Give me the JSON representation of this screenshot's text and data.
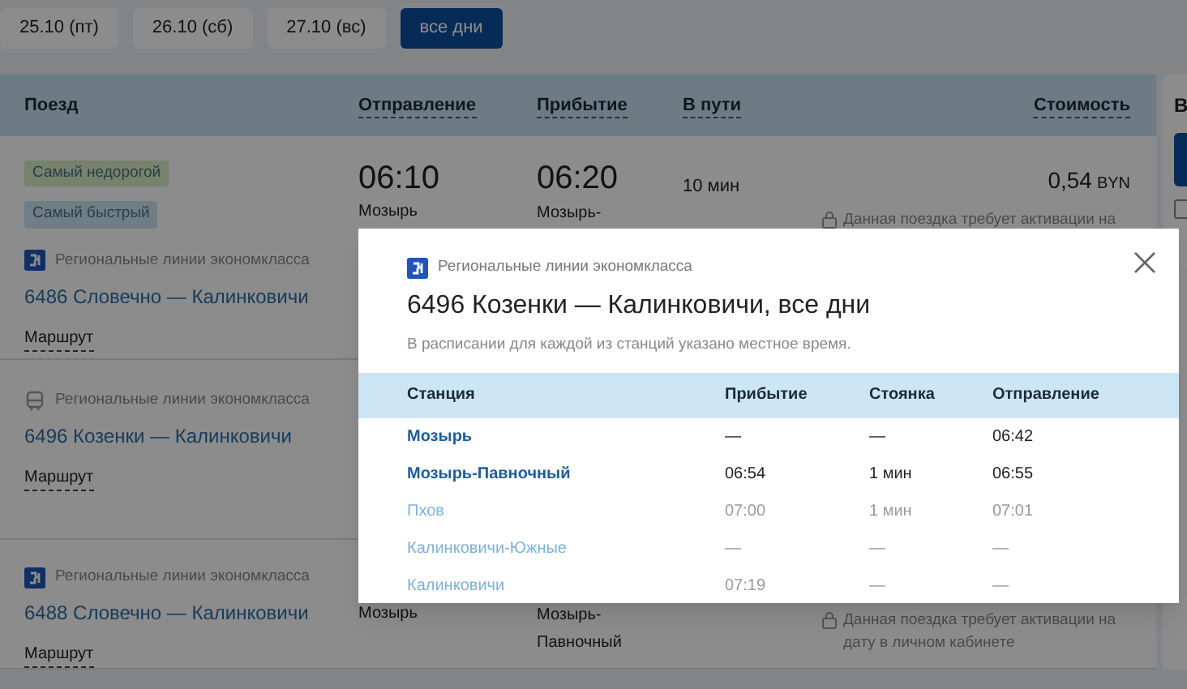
{
  "date_tabs": [
    {
      "label": "25.10 (пт)",
      "selected": false
    },
    {
      "label": "26.10 (сб)",
      "selected": false
    },
    {
      "label": "27.10 (вс)",
      "selected": false
    },
    {
      "label": "все дни",
      "selected": true
    }
  ],
  "table": {
    "columns": [
      "Поезд",
      "Отправление",
      "Прибытие",
      "В пути",
      "Стоимость"
    ],
    "rows": [
      {
        "badges": [
          {
            "label": "Самый недорогой",
            "color": "#76826c"
          },
          {
            "label": "Самый быстрый",
            "color": "#6f7d86"
          }
        ],
        "kind": "logo",
        "operator": "Региональные линии экономкласса",
        "train": "6486 Словечно — Калинковичи",
        "route_link": "Маршрут",
        "departure_time": "06:10",
        "departure_station": "Мозырь",
        "arrival_time": "06:20",
        "arrival_station": "Мозырь-",
        "duration": "10 мин",
        "price": "0,54",
        "currency": "BYN",
        "notice": "Данная поездка требует активации на"
      },
      {
        "kind": "train",
        "operator": "Региональные линии экономкласса",
        "train": "6496 Козенки — Калинковичи",
        "route_link": "Маршрут"
      },
      {
        "kind": "logo",
        "operator": "Региональные линии экономкласса",
        "train": "6488 Словечно — Калинковичи",
        "route_link": "Маршрут",
        "departure_station": "Мозырь",
        "arrival_station": "Мозырь-Павночный",
        "notice": "Данная поездка требует активации на дату в личном кабинете"
      }
    ]
  },
  "side_panel": {
    "title": "В",
    "checkbox": {
      "checked": false
    }
  },
  "modal": {
    "operator": "Региональные линии экономкласса",
    "title": "6496 Козенки — Калинковичи, все дни",
    "note": "В расписании для каждой из станций указано местное время.",
    "columns": [
      "Станция",
      "Прибытие",
      "Стоянка",
      "Отправление"
    ],
    "stops": [
      {
        "station": "Мозырь",
        "arrival": "—",
        "stop": "—",
        "departure": "06:42",
        "in_route": true
      },
      {
        "station": "Мозырь-Павночный",
        "arrival": "06:54",
        "stop": "1 мин",
        "departure": "06:55",
        "in_route": true
      },
      {
        "station": "Пхов",
        "arrival": "07:00",
        "stop": "1 мин",
        "departure": "07:01",
        "in_route": false
      },
      {
        "station": "Калинковичи-Южные",
        "arrival": "—",
        "stop": "—",
        "departure": "—",
        "in_route": false
      },
      {
        "station": "Калинковичи",
        "arrival": "07:19",
        "stop": "—",
        "departure": "—",
        "in_route": false
      }
    ]
  }
}
